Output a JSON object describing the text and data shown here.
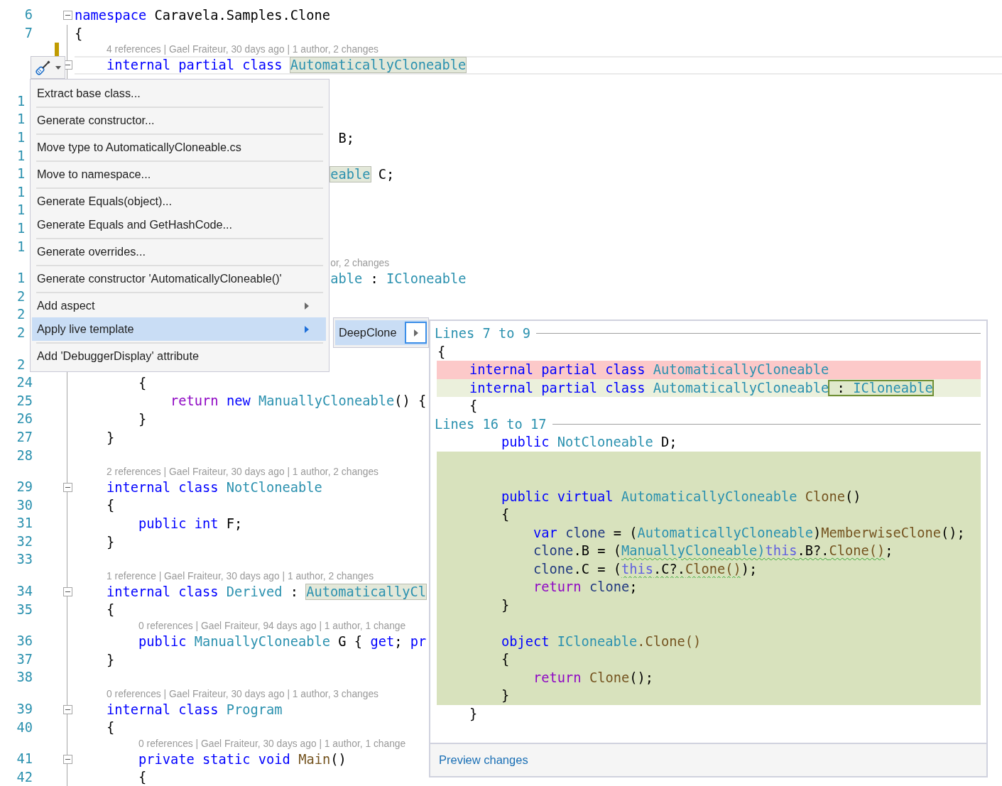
{
  "editor": {
    "lines": [
      {
        "kind": "code",
        "number": "6",
        "fold": true,
        "segments": [
          {
            "text": "namespace",
            "color": "#0000ff"
          },
          {
            "text": " Caravela.Samples.Clone",
            "color": "#000000"
          }
        ]
      },
      {
        "kind": "code",
        "number": "7",
        "segments": [
          {
            "text": "{",
            "color": "#000000"
          }
        ]
      },
      {
        "kind": "lens",
        "text": "4 references | Gael Fraiteur, 30 days ago | 1 author, 2 changes",
        "changed": true
      },
      {
        "kind": "code",
        "fold": true,
        "current": true,
        "segments": [
          {
            "text": "    internal",
            "color": "#0000ff"
          },
          {
            "text": " partial",
            "color": "#0000ff"
          },
          {
            "text": " class ",
            "color": "#0000ff"
          },
          {
            "text": "AutomaticallyCloneable",
            "color": "#2b91af",
            "highlight": true
          }
        ]
      },
      {
        "kind": "code"
      },
      {
        "kind": "code",
        "number": "1",
        "clipped": true
      },
      {
        "kind": "code",
        "number": "1",
        "clipped": true
      },
      {
        "kind": "code",
        "number": "1",
        "clipped": true,
        "segments": [
          {
            "text": "                                 B;",
            "color": "#000000"
          }
        ]
      },
      {
        "kind": "code",
        "number": "1",
        "clipped": true
      },
      {
        "kind": "code",
        "number": "1",
        "clipped": true,
        "segments": [
          {
            "text": "                                eable",
            "color": "#2b91af",
            "highlight": true
          },
          {
            "text": " C;",
            "color": "#000000"
          }
        ]
      },
      {
        "kind": "code",
        "number": "1",
        "clipped": true
      },
      {
        "kind": "code",
        "number": "1",
        "clipped": true
      },
      {
        "kind": "code",
        "number": "1",
        "clipped": true
      },
      {
        "kind": "code",
        "number": "1",
        "clipped": true
      },
      {
        "kind": "lens",
        "text": "or, 2 changes"
      },
      {
        "kind": "code",
        "number": "1",
        "clipped": true,
        "segments": [
          {
            "text": "                                able",
            "color": "#2b91af"
          },
          {
            "text": " :",
            "color": "#000000"
          },
          {
            "text": " ICloneable",
            "color": "#2b91af"
          }
        ]
      },
      {
        "kind": "code",
        "number": "2",
        "clipped": true
      },
      {
        "kind": "code",
        "number": "2",
        "clipped": true
      },
      {
        "kind": "code",
        "number": "2",
        "clipped": true
      },
      {
        "kind": "lens"
      },
      {
        "kind": "code",
        "number": "2",
        "clipped": true
      },
      {
        "kind": "code",
        "number": "24",
        "segments": [
          {
            "text": "        {",
            "color": "#000000"
          }
        ]
      },
      {
        "kind": "code",
        "number": "25",
        "segments": [
          {
            "text": "            return",
            "color": "#8f08c4"
          },
          {
            "text": " new",
            "color": "#0000ff"
          },
          {
            "text": " ManuallyCloneable",
            "color": "#2b91af"
          },
          {
            "text": "() {",
            "color": "#000000"
          }
        ]
      },
      {
        "kind": "code",
        "number": "26",
        "segments": [
          {
            "text": "        }",
            "color": "#000000"
          }
        ]
      },
      {
        "kind": "code",
        "number": "27",
        "segments": [
          {
            "text": "    }",
            "color": "#000000"
          }
        ]
      },
      {
        "kind": "code",
        "number": "28"
      },
      {
        "kind": "lens",
        "text": "2 references | Gael Fraiteur, 30 days ago | 1 author, 2 changes"
      },
      {
        "kind": "code",
        "number": "29",
        "fold": true,
        "segments": [
          {
            "text": "    internal",
            "color": "#0000ff"
          },
          {
            "text": " class",
            "color": "#0000ff"
          },
          {
            "text": " NotCloneable",
            "color": "#2b91af"
          }
        ]
      },
      {
        "kind": "code",
        "number": "30",
        "segments": [
          {
            "text": "    {",
            "color": "#000000"
          }
        ]
      },
      {
        "kind": "code",
        "number": "31",
        "segments": [
          {
            "text": "        public",
            "color": "#0000ff"
          },
          {
            "text": " int",
            "color": "#0000ff"
          },
          {
            "text": " F;",
            "color": "#000000"
          }
        ]
      },
      {
        "kind": "code",
        "number": "32",
        "segments": [
          {
            "text": "    }",
            "color": "#000000"
          }
        ]
      },
      {
        "kind": "code",
        "number": "33"
      },
      {
        "kind": "lens",
        "text": "1 reference | Gael Fraiteur, 30 days ago | 1 author, 2 changes"
      },
      {
        "kind": "code",
        "number": "34",
        "fold": true,
        "segments": [
          {
            "text": "    internal",
            "color": "#0000ff"
          },
          {
            "text": " class",
            "color": "#0000ff"
          },
          {
            "text": " Derived",
            "color": "#2b91af"
          },
          {
            "text": " : ",
            "color": "#000000"
          },
          {
            "text": "AutomaticallyCl",
            "color": "#2b91af",
            "highlight": true
          }
        ]
      },
      {
        "kind": "code",
        "number": "35",
        "segments": [
          {
            "text": "    {",
            "color": "#000000"
          }
        ]
      },
      {
        "kind": "lens",
        "text": "0 references | Gael Fraiteur, 94 days ago | 1 author, 1 change"
      },
      {
        "kind": "code",
        "number": "36",
        "segments": [
          {
            "text": "        public",
            "color": "#0000ff"
          },
          {
            "text": " ManuallyCloneable",
            "color": "#2b91af"
          },
          {
            "text": " G {",
            "color": "#000000"
          },
          {
            "text": " get",
            "color": "#0000ff"
          },
          {
            "text": ";",
            "color": "#000000"
          },
          {
            "text": " pr",
            "color": "#0000ff"
          }
        ]
      },
      {
        "kind": "code",
        "number": "37",
        "segments": [
          {
            "text": "    }",
            "color": "#000000"
          }
        ]
      },
      {
        "kind": "code",
        "number": "38"
      },
      {
        "kind": "lens",
        "text": "0 references | Gael Fraiteur, 30 days ago | 1 author, 3 changes"
      },
      {
        "kind": "code",
        "number": "39",
        "fold": true,
        "segments": [
          {
            "text": "    internal",
            "color": "#0000ff"
          },
          {
            "text": " class",
            "color": "#0000ff"
          },
          {
            "text": " Program",
            "color": "#2b91af"
          }
        ]
      },
      {
        "kind": "code",
        "number": "40",
        "segments": [
          {
            "text": "    {",
            "color": "#000000"
          }
        ]
      },
      {
        "kind": "lens",
        "text": "0 references | Gael Fraiteur, 30 days ago | 1 author, 1 change"
      },
      {
        "kind": "code",
        "number": "41",
        "fold": true,
        "segments": [
          {
            "text": "        private",
            "color": "#0000ff"
          },
          {
            "text": " static",
            "color": "#0000ff"
          },
          {
            "text": " void",
            "color": "#0000ff"
          },
          {
            "text": " Main",
            "color": "#74531f"
          },
          {
            "text": "()",
            "color": "#000000"
          }
        ]
      },
      {
        "kind": "code",
        "number": "42",
        "segments": [
          {
            "text": "        {",
            "color": "#000000"
          }
        ]
      }
    ]
  },
  "context_menu": {
    "groups": [
      [
        {
          "label": "Extract base class...",
          "selected": false
        }
      ],
      [
        {
          "label": "Generate constructor...",
          "selected": false
        }
      ],
      [
        {
          "label": "Move type to AutomaticallyCloneable.cs",
          "selected": false
        }
      ],
      [
        {
          "label": "Move to namespace...",
          "selected": false
        }
      ],
      [
        {
          "label": "Generate Equals(object)...",
          "selected": false
        },
        {
          "label": "Generate Equals and GetHashCode...",
          "selected": false
        }
      ],
      [
        {
          "label": "Generate overrides...",
          "selected": false
        }
      ],
      [
        {
          "label": "Generate constructor 'AutomaticallyCloneable()'",
          "selected": false
        }
      ],
      [
        {
          "label": "Add aspect",
          "selected": false,
          "submenu": true
        },
        {
          "label": "Apply live template",
          "selected": true,
          "submenu": true
        }
      ],
      [
        {
          "label": "Add 'DebuggerDisplay' attribute",
          "selected": false
        }
      ]
    ]
  },
  "submenu": {
    "items": [
      {
        "label": "DeepClone",
        "selected": true,
        "submenu": true
      }
    ]
  },
  "preview": {
    "sections": [
      {
        "header": "Lines 7 to 9",
        "lines": [
          {
            "kind": "context",
            "segments": [
              {
                "text": "{",
                "color": "#000000"
              }
            ]
          },
          {
            "kind": "removed",
            "segments": [
              {
                "text": "    internal",
                "color": "#0000ff"
              },
              {
                "text": " partial",
                "color": "#0000ff"
              },
              {
                "text": " class",
                "color": "#0000ff"
              },
              {
                "text": " AutomaticallyCloneable",
                "color": "#2b91af"
              }
            ]
          },
          {
            "kind": "modified",
            "segments": [
              {
                "text": "    internal",
                "color": "#0000ff"
              },
              {
                "text": " partial",
                "color": "#0000ff"
              },
              {
                "text": " class",
                "color": "#0000ff"
              },
              {
                "text": " AutomaticallyCloneable",
                "color": "#2b91af"
              },
              {
                "text": " :",
                "color": "#000000",
                "boxed": true
              },
              {
                "text": " ICloneable",
                "color": "#2b91af",
                "boxed": true
              }
            ]
          },
          {
            "kind": "context",
            "segments": [
              {
                "text": "    {",
                "color": "#000000"
              }
            ]
          }
        ]
      },
      {
        "header": "Lines 16 to 17",
        "lines": [
          {
            "kind": "context",
            "segments": [
              {
                "text": "        public",
                "color": "#0000ff"
              },
              {
                "text": " NotCloneable",
                "color": "#2b91af"
              },
              {
                "text": " D;",
                "color": "#000000"
              }
            ]
          },
          {
            "kind": "added"
          },
          {
            "kind": "added"
          },
          {
            "kind": "added",
            "segments": [
              {
                "text": "        public",
                "color": "#0000ff"
              },
              {
                "text": " virtual",
                "color": "#0000ff"
              },
              {
                "text": " AutomaticallyCloneable",
                "color": "#2b91af"
              },
              {
                "text": " Clone",
                "color": "#74531f"
              },
              {
                "text": "()",
                "color": "#000000"
              }
            ]
          },
          {
            "kind": "added",
            "segments": [
              {
                "text": "        {",
                "color": "#000000"
              }
            ]
          },
          {
            "kind": "added",
            "segments": [
              {
                "text": "            var",
                "color": "#0000ff"
              },
              {
                "text": " clone",
                "color": "#1f377f"
              },
              {
                "text": " = (",
                "color": "#000000"
              },
              {
                "text": "AutomaticallyCloneable",
                "color": "#2b91af"
              },
              {
                "text": ")",
                "color": "#000000"
              },
              {
                "text": "MemberwiseClone",
                "color": "#74531f"
              },
              {
                "text": "();",
                "color": "#000000"
              }
            ]
          },
          {
            "kind": "added",
            "segments": [
              {
                "text": "            clone",
                "color": "#1f377f"
              },
              {
                "text": ".B = (",
                "color": "#000000"
              },
              {
                "text": "ManuallyCloneable)",
                "color": "#2b91af",
                "squiggle": true
              },
              {
                "text": "this",
                "color": "#6060e0",
                "squiggle": true
              },
              {
                "text": ".B?.",
                "color": "#000000",
                "squiggle": true
              },
              {
                "text": "Clone()",
                "color": "#74531f",
                "squiggle": true
              },
              {
                "text": ";",
                "color": "#000000"
              }
            ]
          },
          {
            "kind": "added",
            "segments": [
              {
                "text": "            clone",
                "color": "#1f377f"
              },
              {
                "text": ".C = (",
                "color": "#000000"
              },
              {
                "text": "this",
                "color": "#6060e0",
                "squiggle": true
              },
              {
                "text": ".C?.",
                "color": "#000000",
                "squiggle": true
              },
              {
                "text": "Clone()",
                "color": "#74531f",
                "squiggle": true
              },
              {
                "text": ");",
                "color": "#000000"
              }
            ]
          },
          {
            "kind": "added",
            "segments": [
              {
                "text": "            return",
                "color": "#8f08c4"
              },
              {
                "text": " clone",
                "color": "#1f377f"
              },
              {
                "text": ";",
                "color": "#000000"
              }
            ]
          },
          {
            "kind": "added",
            "segments": [
              {
                "text": "        }",
                "color": "#000000"
              }
            ]
          },
          {
            "kind": "added"
          },
          {
            "kind": "added",
            "segments": [
              {
                "text": "        object",
                "color": "#0000ff"
              },
              {
                "text": " ICloneable",
                "color": "#2b91af"
              },
              {
                "text": ".Clone()",
                "color": "#74531f"
              }
            ]
          },
          {
            "kind": "added",
            "segments": [
              {
                "text": "        {",
                "color": "#000000"
              }
            ]
          },
          {
            "kind": "added",
            "segments": [
              {
                "text": "            return",
                "color": "#8f08c4"
              },
              {
                "text": " Clone",
                "color": "#74531f"
              },
              {
                "text": "();",
                "color": "#000000"
              }
            ]
          },
          {
            "kind": "added",
            "segments": [
              {
                "text": "        }",
                "color": "#000000"
              }
            ]
          },
          {
            "kind": "context",
            "segments": [
              {
                "text": "    }",
                "color": "#000000"
              }
            ]
          }
        ]
      }
    ],
    "footer_link": "Preview changes"
  }
}
